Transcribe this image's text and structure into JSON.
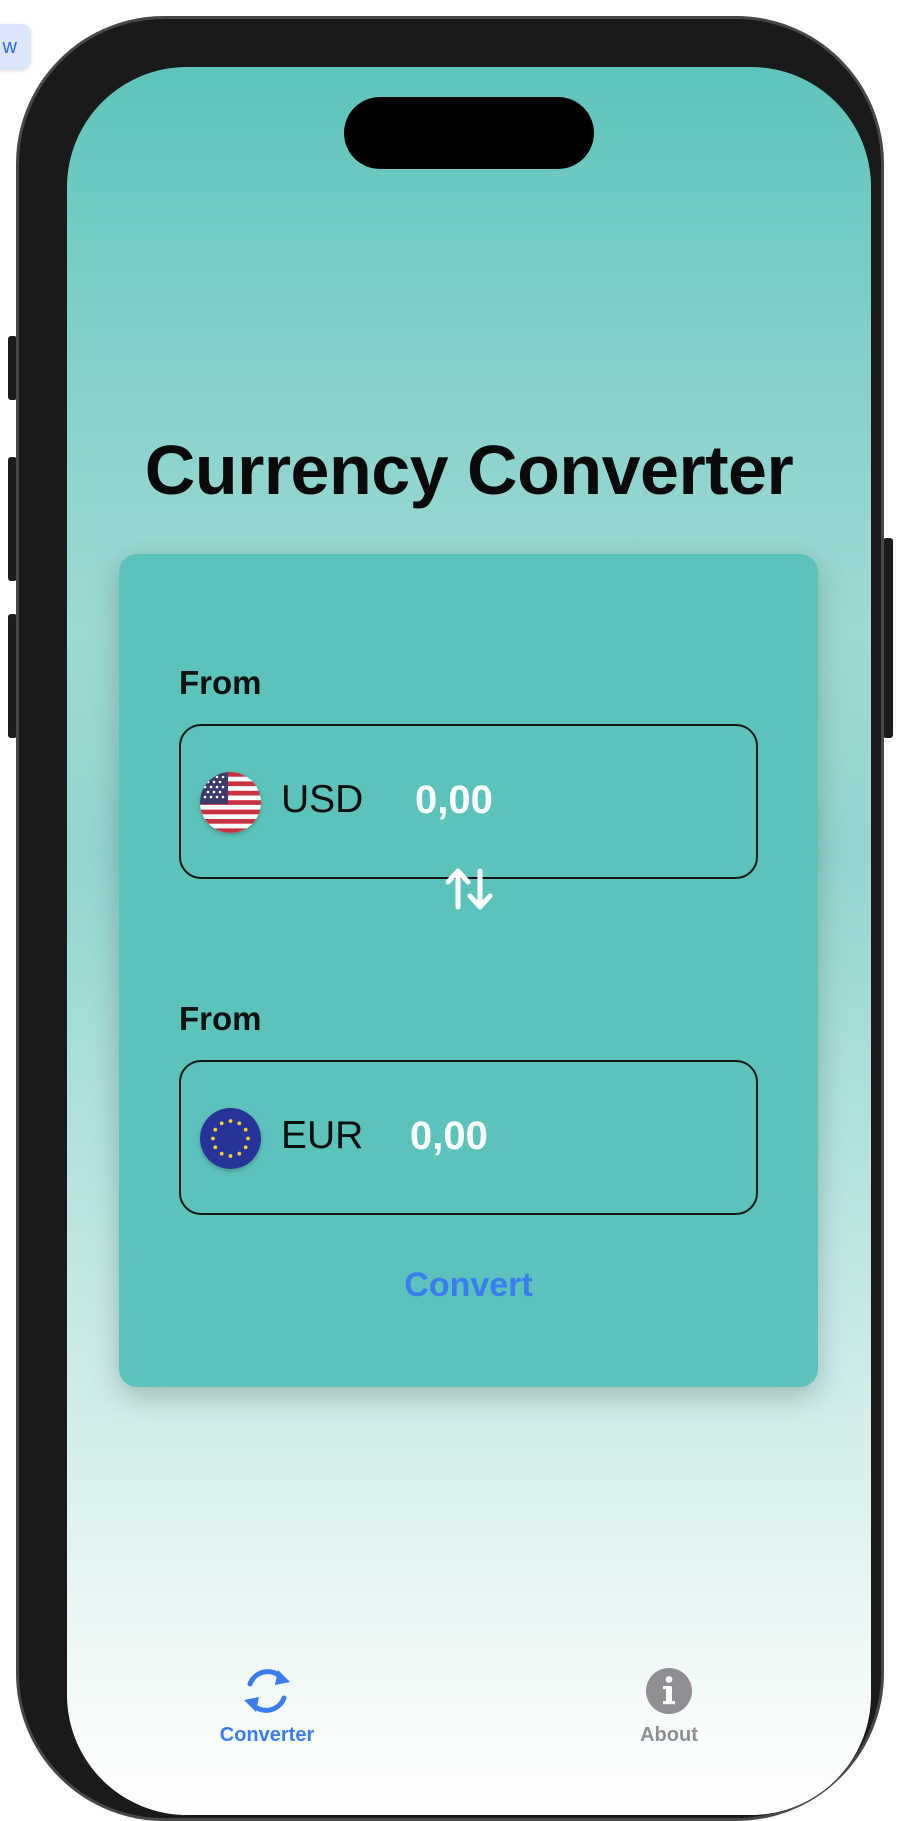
{
  "preview_chip": {
    "label": "w"
  },
  "app": {
    "title": "Currency Converter"
  },
  "converter": {
    "from": {
      "label": "From",
      "currency_code": "USD",
      "flag_icon": "us-flag-icon",
      "amount": "0,00"
    },
    "swap_icon": "swap-arrows-icon",
    "to": {
      "label": "From",
      "currency_code": "EUR",
      "flag_icon": "eu-flag-icon",
      "amount": "0,00"
    },
    "convert_label": "Convert"
  },
  "tab_bar": {
    "tabs": [
      {
        "label": "Converter",
        "icon": "refresh-cycle-icon",
        "selected": true
      },
      {
        "label": "About",
        "icon": "info-icon",
        "selected": false
      }
    ]
  },
  "colors": {
    "accent": "#3a7df0",
    "card": "#5bc3bb",
    "tab_inactive": "#8e8e93"
  }
}
